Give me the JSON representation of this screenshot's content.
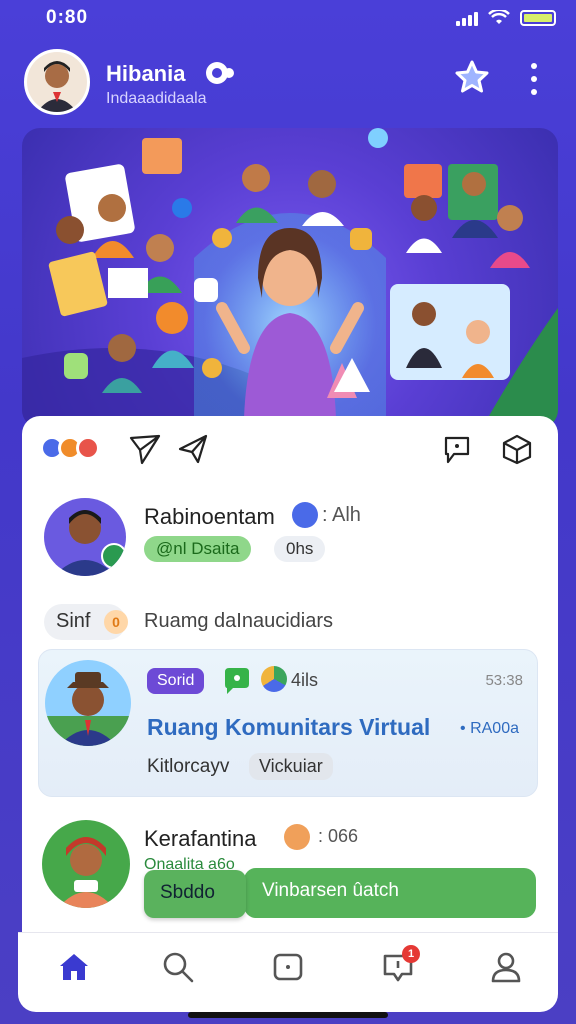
{
  "status_bar": {
    "time": "0:80"
  },
  "header": {
    "title": "Hibania",
    "subtitle": "Indaaadidaala"
  },
  "toolbar": {
    "icons": [
      "app-logo-icon",
      "send-icon",
      "share-icon",
      "comment-icon",
      "cube-icon"
    ]
  },
  "profile": {
    "name": "Rabinoentam",
    "meta": ": Alh",
    "chip_status": "@nl Dsaita",
    "chip_time": "0hs",
    "sinf_label": "Sinf",
    "sinf_badge": "0",
    "sinf_text": "Ruamg daInaucidiars"
  },
  "highlight": {
    "tag": "Sorid",
    "meta": "4ils",
    "time": "53:38",
    "title": "Ruang Komunitars Virtual",
    "tag2": "• RA00a",
    "subtitle": "Kitlorcayv",
    "pill": "Vickuiar"
  },
  "entry": {
    "name": "Kerafantina",
    "meta": ": 066",
    "subtitle": "Onaalita a6o",
    "button_a": "Sbddo",
    "button_b": "Vinbarsen ûatch"
  },
  "bottom_nav": {
    "items": [
      "home-icon",
      "search-icon",
      "camera-icon",
      "notifications-icon",
      "profile-icon"
    ],
    "notification_badge": "1"
  },
  "colors": {
    "primary": "#4a3fd8",
    "accent_green": "#56b35a",
    "title_blue": "#2f6bc0"
  }
}
